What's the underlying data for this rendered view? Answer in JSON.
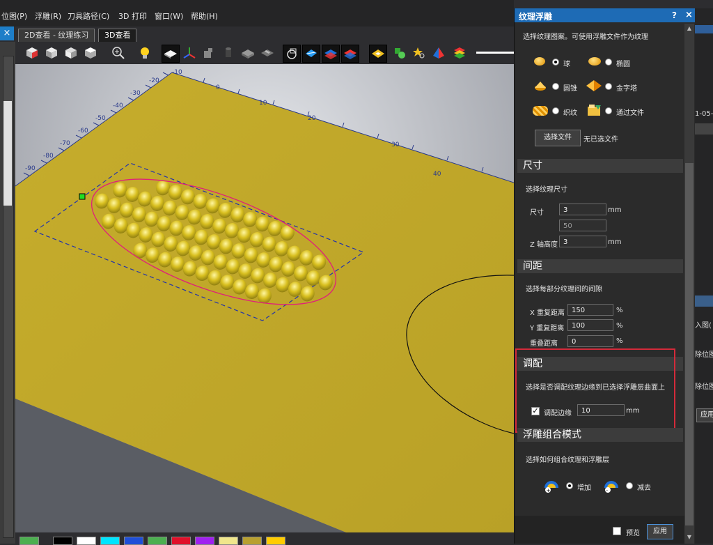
{
  "menu": [
    "位图(P)",
    "浮雕(R)",
    "刀具路径(C)",
    "3D 打印",
    "窗口(W)",
    "帮助(H)"
  ],
  "tabs": [
    "2D查看 - 纹理练习",
    "3D查看"
  ],
  "tab_close": "×",
  "palette": [
    "#4caf50",
    "#000000",
    "#ffffff",
    "#00e5ff",
    "#1f4fd8",
    "#4caf50",
    "#e0102a",
    "#a020f0",
    "#f0e68c",
    "#b8a030",
    "#ffcc00"
  ],
  "panel": {
    "title": "纹理浮雕",
    "help": "?",
    "close": "×",
    "intro": "选择纹理图案。可使用浮雕文件作为纹理",
    "shapes": [
      {
        "label": "球",
        "icon": "sphere-icon",
        "selected": true
      },
      {
        "label": "椭圆",
        "icon": "ellipse-icon",
        "selected": false
      },
      {
        "label": "圆锥",
        "icon": "cone-icon",
        "selected": false
      },
      {
        "label": "金字塔",
        "icon": "pyramid-icon",
        "selected": false
      },
      {
        "label": "织纹",
        "icon": "weave-icon",
        "selected": false
      },
      {
        "label": "通过文件",
        "icon": "file-icon",
        "selected": false
      }
    ],
    "select_file_button": "选择文件",
    "no_file_text": "无已选文件",
    "size_section": {
      "title": "尺寸",
      "desc": "选择纹理尺寸",
      "size_label": "尺寸",
      "size_value": "3",
      "size_unit": "mm",
      "size_secondary": "50",
      "z_label": "Z 轴高度",
      "z_value": "3",
      "z_unit": "mm"
    },
    "spacing_section": {
      "title": "间距",
      "desc": "选择每部分纹理间的间隙",
      "x_label": "X 重复距离",
      "x_value": "150",
      "y_label": "Y 重复距离",
      "y_value": "100",
      "overlap_label": "重叠距离",
      "overlap_value": "0",
      "unit": "%"
    },
    "fit_section": {
      "title": "调配",
      "desc": "选择是否调配纹理边缘到已选择浮雕层曲面上",
      "checkbox_label": "调配边缘",
      "checked": true,
      "value": "10",
      "unit": "mm"
    },
    "combine_section": {
      "title": "浮雕组合模式",
      "desc": "选择如何组合纹理和浮雕层",
      "add_label": "增加",
      "subtract_label": "减去",
      "add_selected": true
    },
    "preview_label": "预览",
    "apply_button": "应用"
  },
  "far_right": {
    "date_fragment": "1-05-",
    "item1": "入图(",
    "item2": "除位图",
    "item3": "除位图",
    "apply_fragment": "应用"
  },
  "ruler_labels": [
    "-90",
    "-80",
    "-70",
    "-60",
    "-50",
    "-40",
    "-30",
    "-20",
    "-10",
    "0",
    "10",
    "20",
    "30",
    "40"
  ]
}
